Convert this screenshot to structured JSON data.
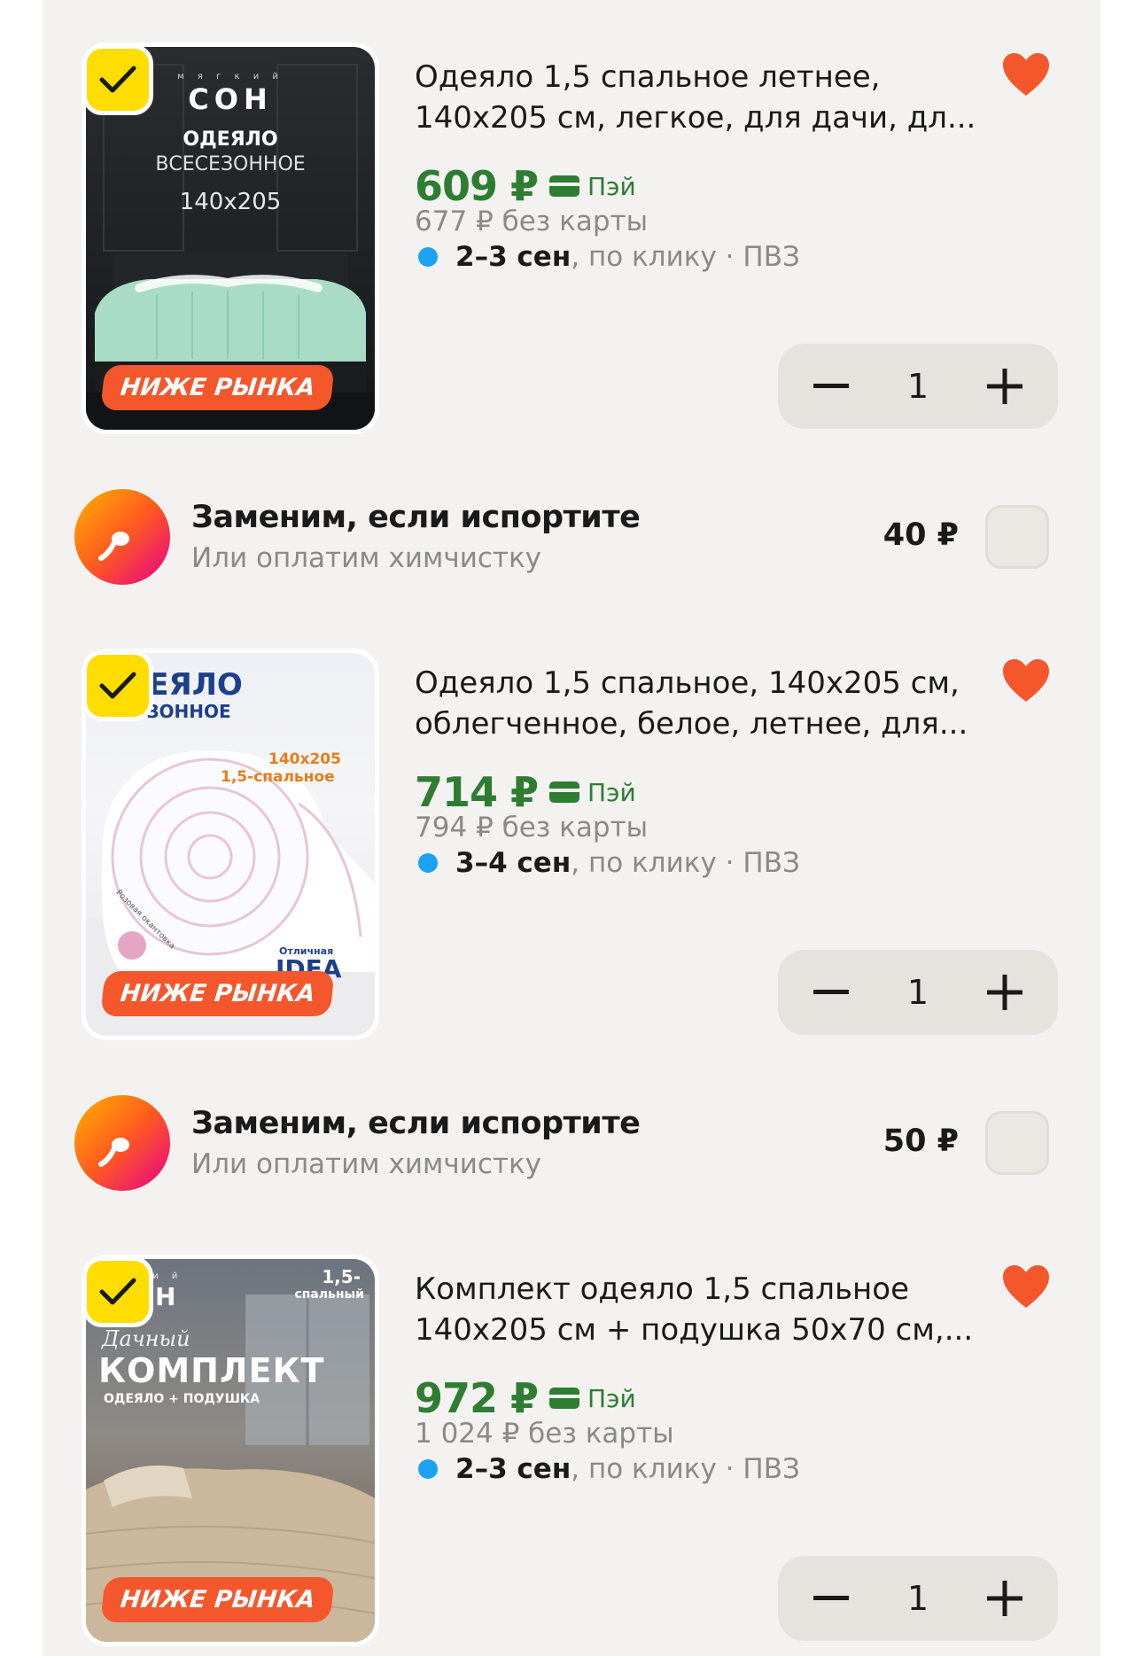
{
  "products": [
    {
      "title_line1": "Одеяло 1,5 спальное летнее,",
      "title_line2": "140х205 см, легкое, для дачи, дл...",
      "price": "609 ₽",
      "pay_label": "Пэй",
      "old_price": "677 ₽  без карты",
      "delivery_date": "2–3 сен",
      "delivery_rest": ", по клику · ПВЗ",
      "quantity": "1",
      "promo": "НИЖЕ РЫНКА",
      "image": {
        "brand_top": "м я г к и й",
        "brand": "СОН",
        "line1": "ОДЕЯЛО",
        "line2": "ВСЕСЕЗОННОЕ",
        "size": "140х205"
      }
    },
    {
      "title_line1": "Одеяло 1,5 спальное, 140х205 см,",
      "title_line2": "облегченное, белое, летнее, для...",
      "price": "714 ₽",
      "pay_label": "Пэй",
      "old_price": "794 ₽  без карты",
      "delivery_date": "3–4 сен",
      "delivery_rest": ", по клику · ПВЗ",
      "quantity": "1",
      "promo": "НИЖЕ РЫНКА",
      "image": {
        "line1": "ДЕЯЛО",
        "line2": "СЕЗОННОЕ",
        "size": "140х205",
        "sub": "1,5-спальное",
        "edge": "Розовая окантовка",
        "brand_small": "Отличная",
        "brand": "IDEA"
      }
    },
    {
      "title_line1": "Комплект одеяло 1,5 спальное",
      "title_line2": "140х205 см + подушка 50х70 см,...",
      "price": "972 ₽",
      "pay_label": "Пэй",
      "old_price": "1 024 ₽  без карты",
      "delivery_date": "2–3 сен",
      "delivery_rest": ", по клику · ПВЗ",
      "quantity": "1",
      "promo": "НИЖЕ РЫНКА",
      "image": {
        "brand_top": "к и й",
        "brand": "Н",
        "corner1": "1,5-",
        "corner2": "спальный",
        "script": "Дачный",
        "line1": "КОМПЛЕКТ",
        "line2": "ОДЕЯЛО + ПОДУШКА"
      }
    }
  ],
  "insurance": [
    {
      "title": "Заменим, если испортите",
      "subtitle": "Или оплатим химчистку",
      "price": "40 ₽"
    },
    {
      "title": "Заменим, если испортите",
      "subtitle": "Или оплатим химчистку",
      "price": "50 ₽"
    }
  ],
  "colors": {
    "price_green": "#2e7d32",
    "heart": "#f4572c",
    "check_yellow": "#ffdd00",
    "promo_orange": "#f4572c",
    "delivery_dot": "#1da1f2"
  }
}
